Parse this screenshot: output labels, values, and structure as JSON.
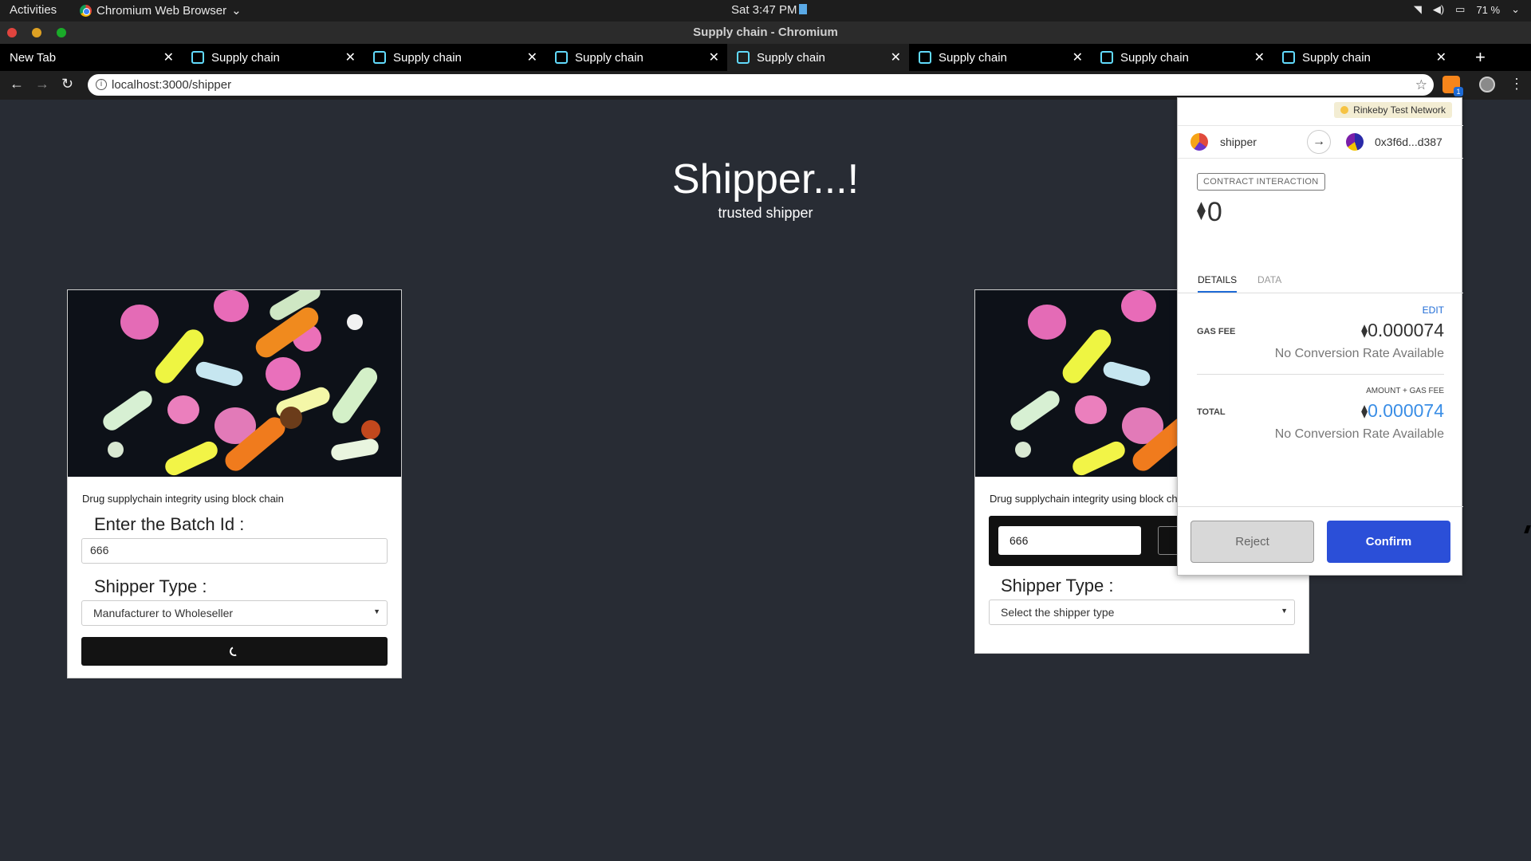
{
  "system": {
    "activities": "Activities",
    "app_name": "Chromium Web Browser",
    "clock": "Sat  3:47 PM",
    "battery": "71 %"
  },
  "window": {
    "title": "Supply chain - Chromium"
  },
  "tabs": [
    {
      "label": "New Tab"
    },
    {
      "label": "Supply chain"
    },
    {
      "label": "Supply chain"
    },
    {
      "label": "Supply chain"
    },
    {
      "label": "Supply chain"
    },
    {
      "label": "Supply chain"
    },
    {
      "label": "Supply chain"
    },
    {
      "label": "Supply chain"
    }
  ],
  "active_tab_index": 4,
  "toolbar": {
    "url": "localhost:3000/shipper",
    "extension_badge": "1"
  },
  "page": {
    "title": "Shipper...!",
    "subtitle": "trusted shipper",
    "card1": {
      "description": "Drug supplychain integrity using block chain",
      "batch_label": "Enter the Batch Id :",
      "batch_value": "666",
      "shipper_label": "Shipper Type :",
      "shipper_value": "Manufacturer to Wholeseller"
    },
    "card2": {
      "description": "Drug supplychain integrity using block chain",
      "batch_value": "666",
      "shipper_label": "Shipper Type :",
      "shipper_value": "Select the shipper type"
    }
  },
  "metamask": {
    "network": "Rinkeby Test Network",
    "from_account": "shipper",
    "to_address": "0x3f6d...d387",
    "interaction_label": "CONTRACT INTERACTION",
    "amount": "0",
    "tab_details": "DETAILS",
    "tab_data": "DATA",
    "edit_label": "EDIT",
    "gas_fee_label": "GAS FEE",
    "gas_fee_value": "0.000074",
    "gas_fee_note": "No Conversion Rate Available",
    "total_hint": "AMOUNT + GAS FEE",
    "total_label": "TOTAL",
    "total_value": "0.000074",
    "total_note": "No Conversion Rate Available",
    "reject_label": "Reject",
    "confirm_label": "Confirm"
  },
  "colors": {
    "page_bg": "#282c34",
    "confirm_button": "#2b4fd8",
    "total_value": "#3a8ee6",
    "network_dot": "#f6c343"
  }
}
